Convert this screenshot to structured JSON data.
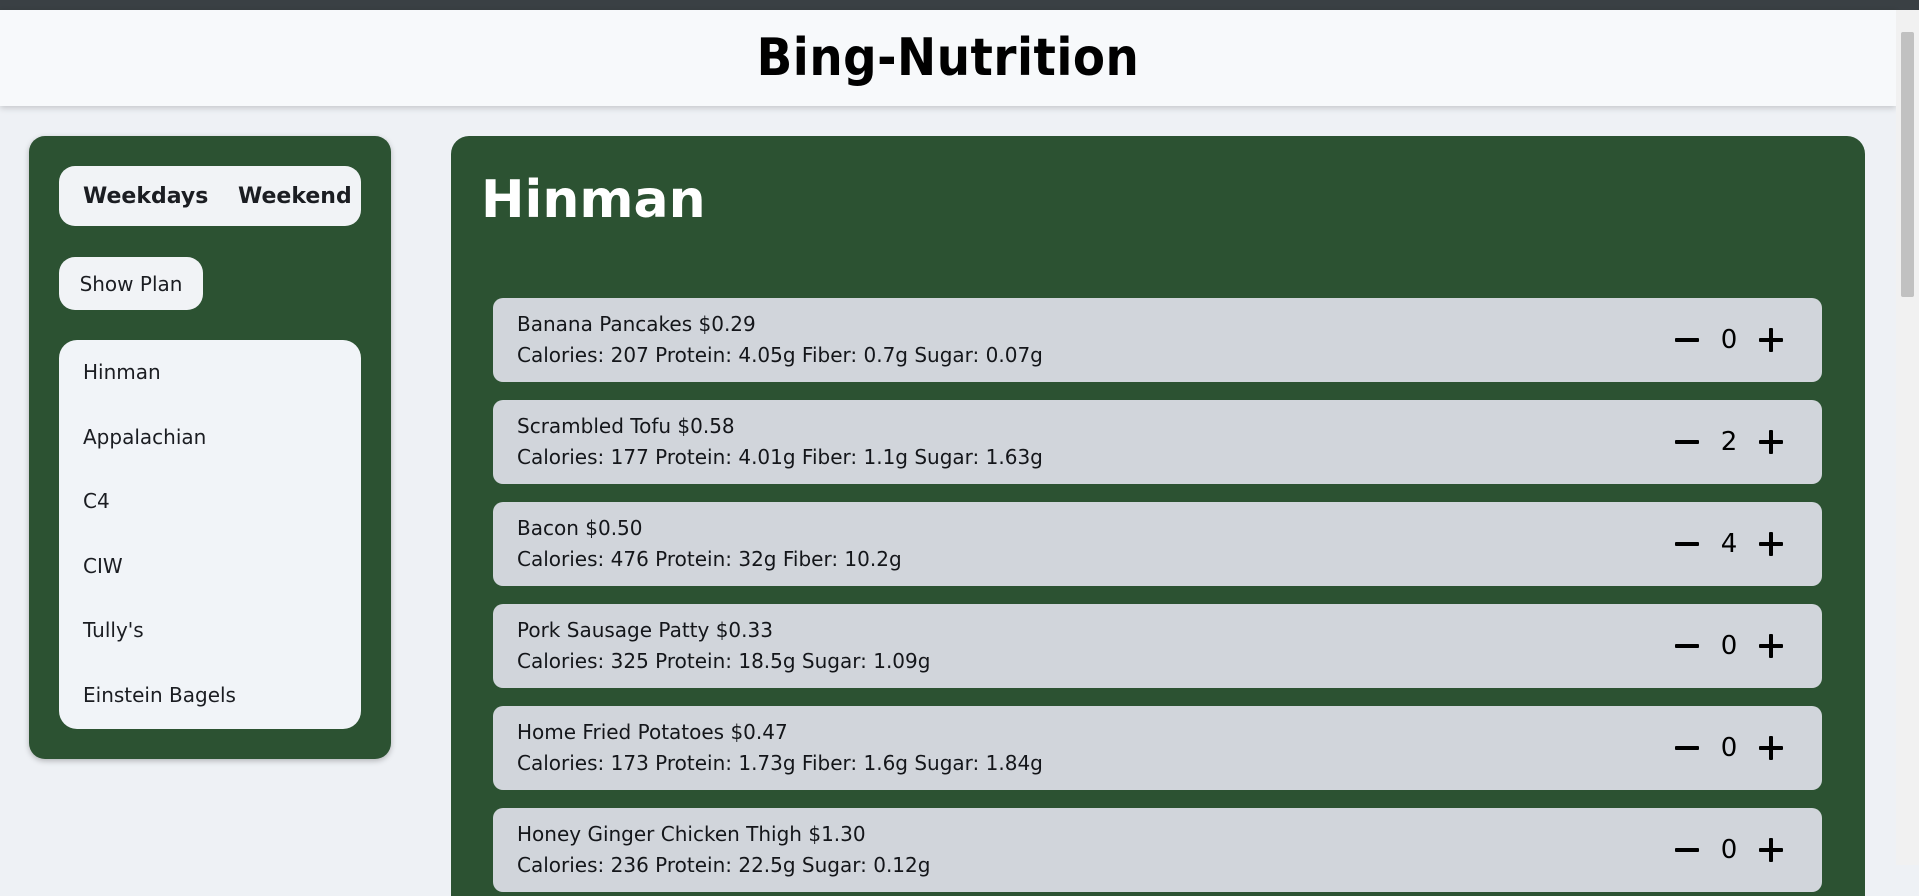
{
  "app": {
    "title": "Bing-Nutrition"
  },
  "sidebar": {
    "tabs": [
      {
        "label": "Weekdays"
      },
      {
        "label": "Weekend"
      }
    ],
    "show_plan_label": "Show Plan",
    "halls": [
      {
        "label": "Hinman"
      },
      {
        "label": "Appalachian"
      },
      {
        "label": "C4"
      },
      {
        "label": "CIW"
      },
      {
        "label": "Tully's"
      },
      {
        "label": "Einstein Bagels"
      }
    ]
  },
  "main": {
    "title": "Hinman",
    "items": [
      {
        "name": "Banana Pancakes $0.29",
        "nutrition": "Calories: 207 Protein: 4.05g Fiber: 0.7g Sugar: 0.07g",
        "qty": "0"
      },
      {
        "name": "Scrambled Tofu $0.58",
        "nutrition": "Calories: 177 Protein: 4.01g Fiber: 1.1g Sugar: 1.63g",
        "qty": "2"
      },
      {
        "name": "Bacon $0.50",
        "nutrition": "Calories: 476 Protein: 32g Fiber: 10.2g",
        "qty": "4"
      },
      {
        "name": "Pork Sausage Patty $0.33",
        "nutrition": "Calories: 325 Protein: 18.5g Sugar: 1.09g",
        "qty": "0"
      },
      {
        "name": "Home Fried Potatoes $0.47",
        "nutrition": "Calories: 173 Protein: 1.73g Fiber: 1.6g Sugar: 1.84g",
        "qty": "0"
      },
      {
        "name": "Honey Ginger Chicken Thigh $1.30",
        "nutrition": "Calories: 236 Protein: 22.5g Sugar: 0.12g",
        "qty": "0"
      }
    ]
  },
  "colors": {
    "accent": "#2c5232",
    "card": "#d1d5db",
    "panel": "#f1f3f6"
  },
  "icons": {
    "decrement": "minus-icon",
    "increment": "plus-icon"
  }
}
